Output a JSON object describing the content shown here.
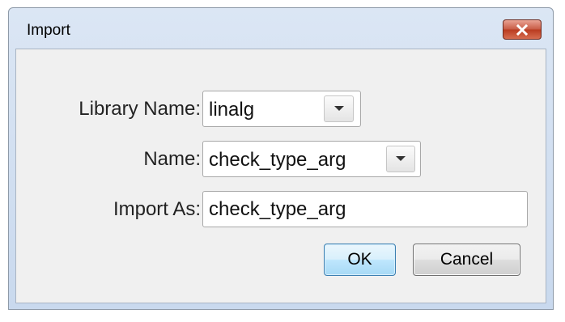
{
  "window": {
    "title": "Import"
  },
  "form": {
    "library_name_label": "Library Name:",
    "library_name_value": "linalg",
    "name_label": "Name:",
    "name_value": "check_type_arg",
    "import_as_label": "Import As:",
    "import_as_value": "check_type_arg"
  },
  "buttons": {
    "ok_label": "OK",
    "cancel_label": "Cancel"
  },
  "icons": {
    "close": "close-icon",
    "dropdown": "chevron-down-icon"
  },
  "colors": {
    "title_bar": "#c9d9ee",
    "close_button": "#c75a43",
    "dialog_background": "#f0f0f0",
    "ok_button_border": "#3c7fb1"
  }
}
